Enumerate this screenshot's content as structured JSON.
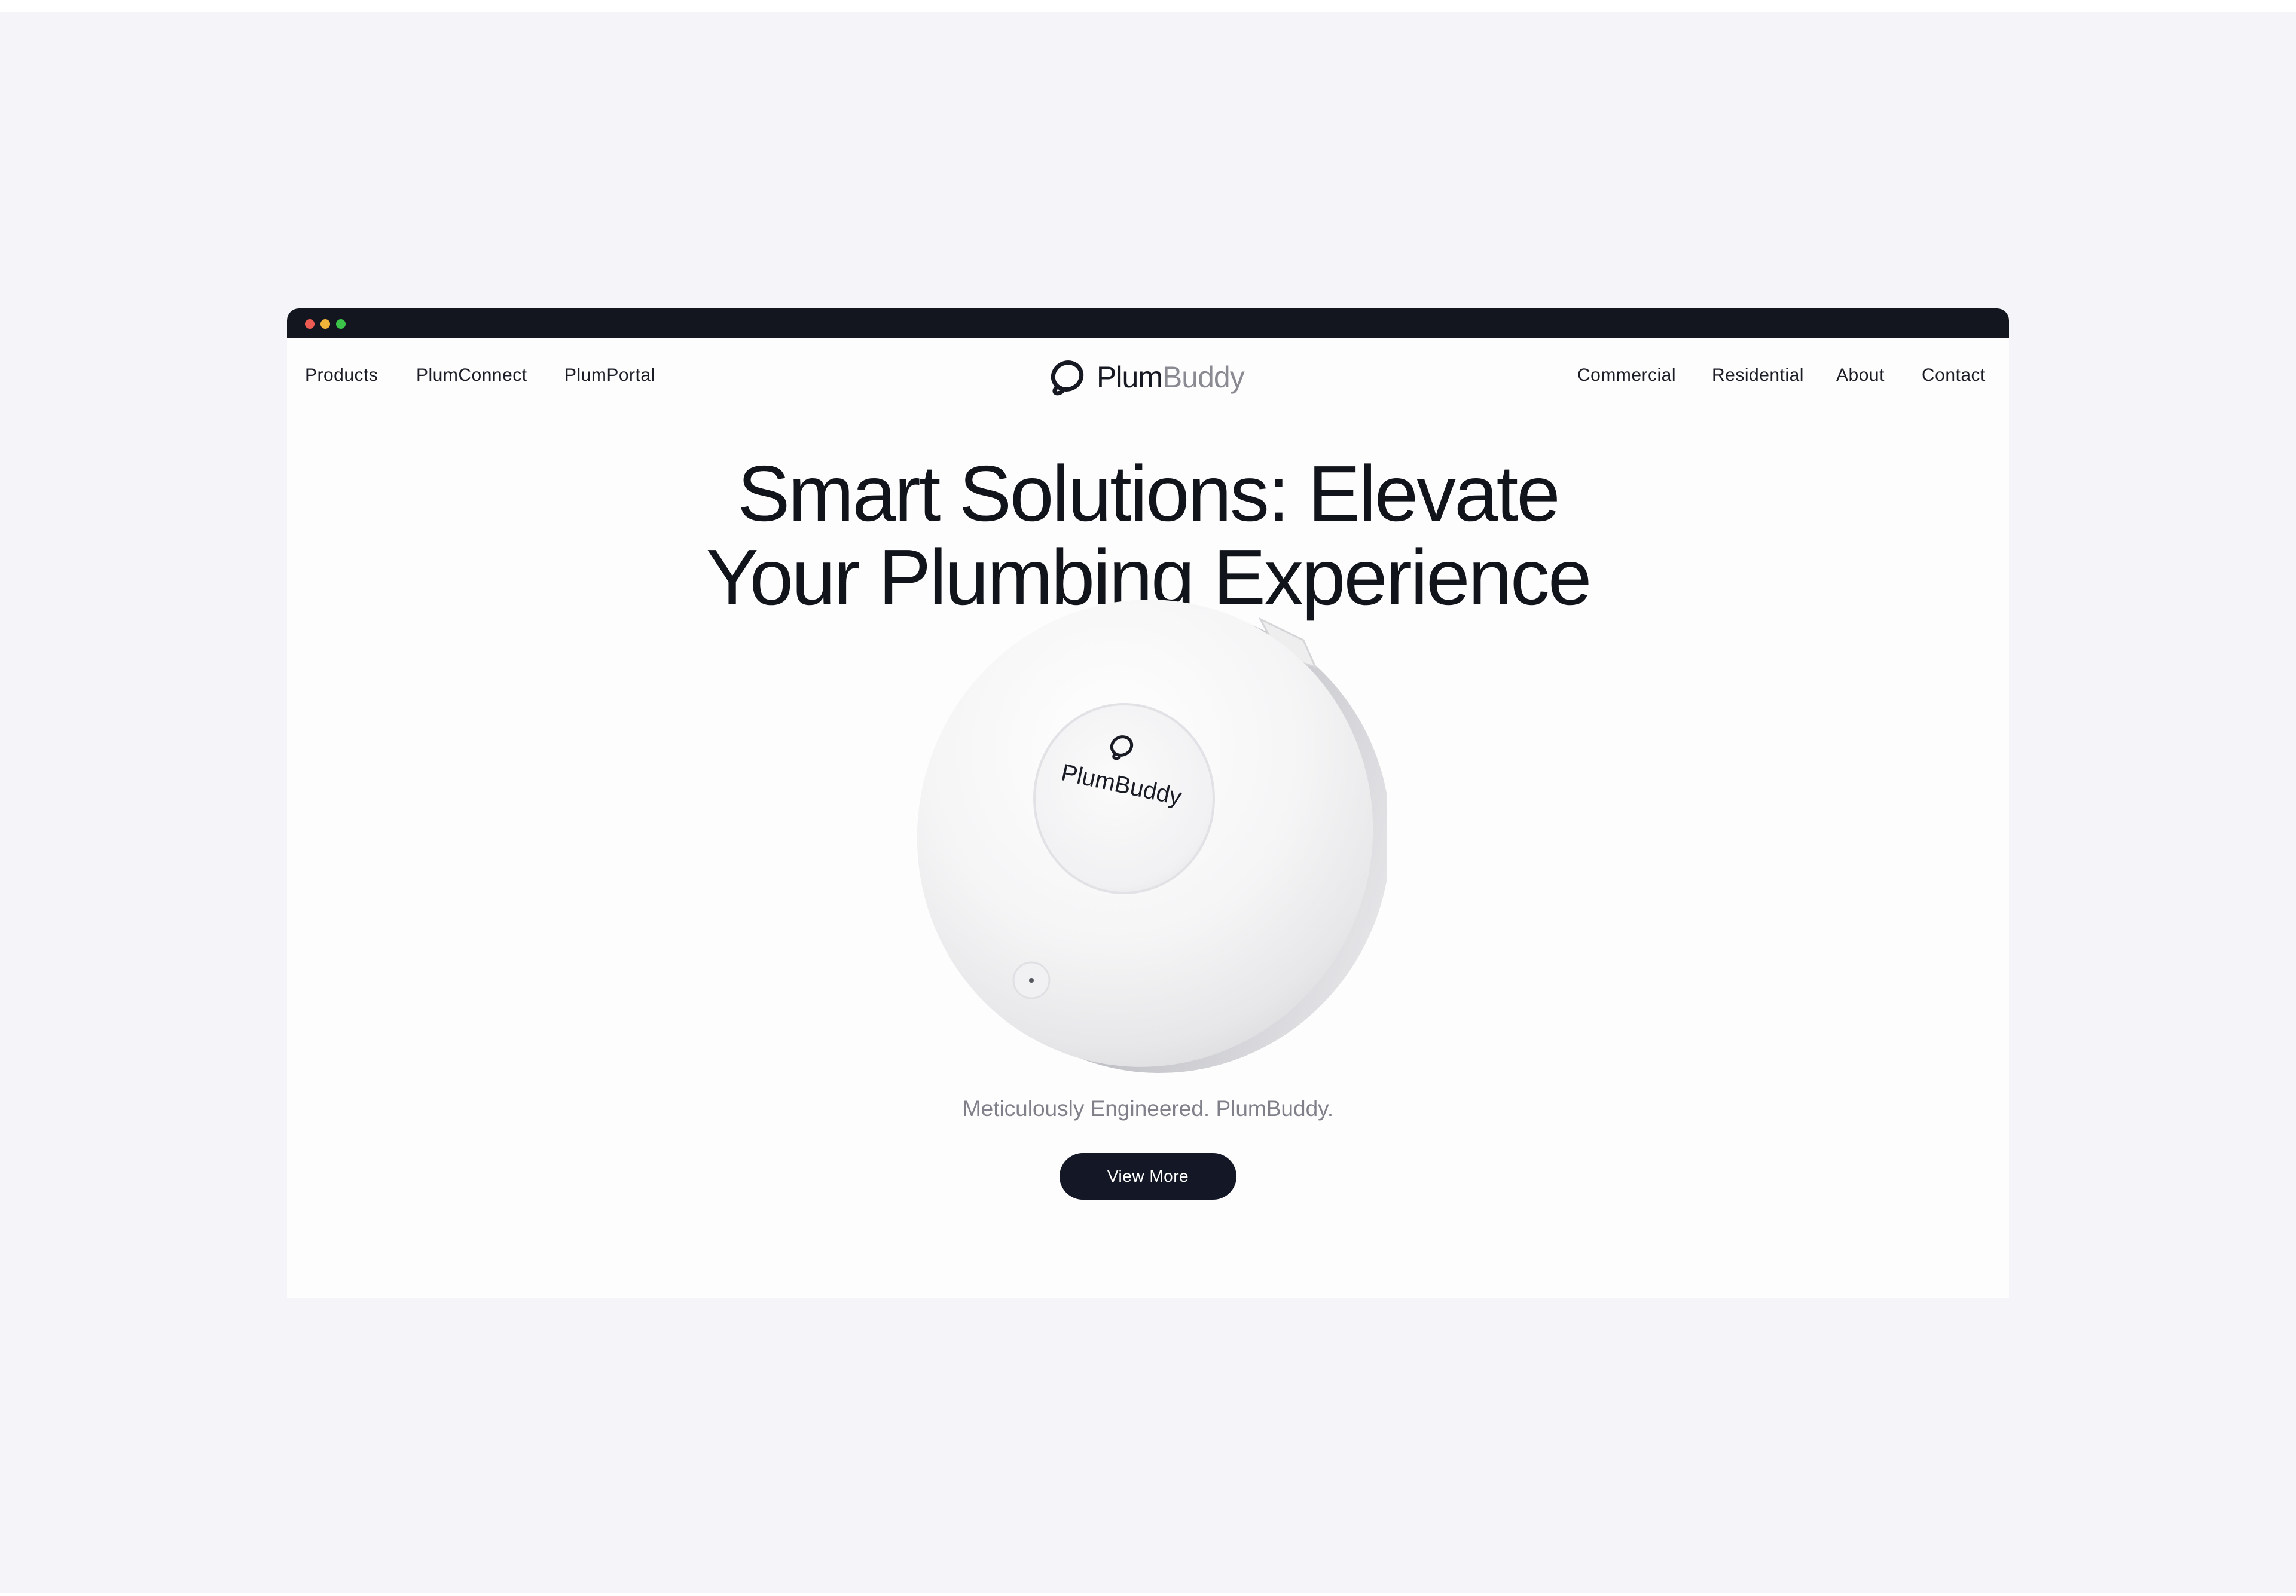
{
  "browser": {
    "traffic_lights": {
      "close_color": "#ee5b53",
      "minimize_color": "#f0b43b",
      "maximize_color": "#3cc34a"
    },
    "titlebar_color": "#14161f"
  },
  "nav": {
    "left_links": [
      "Products",
      "PlumConnect",
      "PlumPortal"
    ],
    "right_links": [
      "Commercial",
      "Residential",
      "About",
      "Contact"
    ]
  },
  "brand": {
    "name_part1": "Plum",
    "name_part2": "Buddy",
    "logo_icon": "plumbuddy-logo-icon"
  },
  "hero": {
    "title_line1": "Smart Solutions: Elevate",
    "title_line2": "Your Plumbing Experience",
    "product_label": "PlumBuddy",
    "product_icon": "plumbuddy-logo-icon",
    "tagline": "Meticulously Engineered. PlumBuddy.",
    "cta_label": "View More",
    "cta_color": "#141725"
  },
  "colors": {
    "page_background": "#f5f5f9",
    "site_background": "#fdfdfd",
    "text_dark": "#12141c",
    "text_muted": "#7f8089"
  }
}
